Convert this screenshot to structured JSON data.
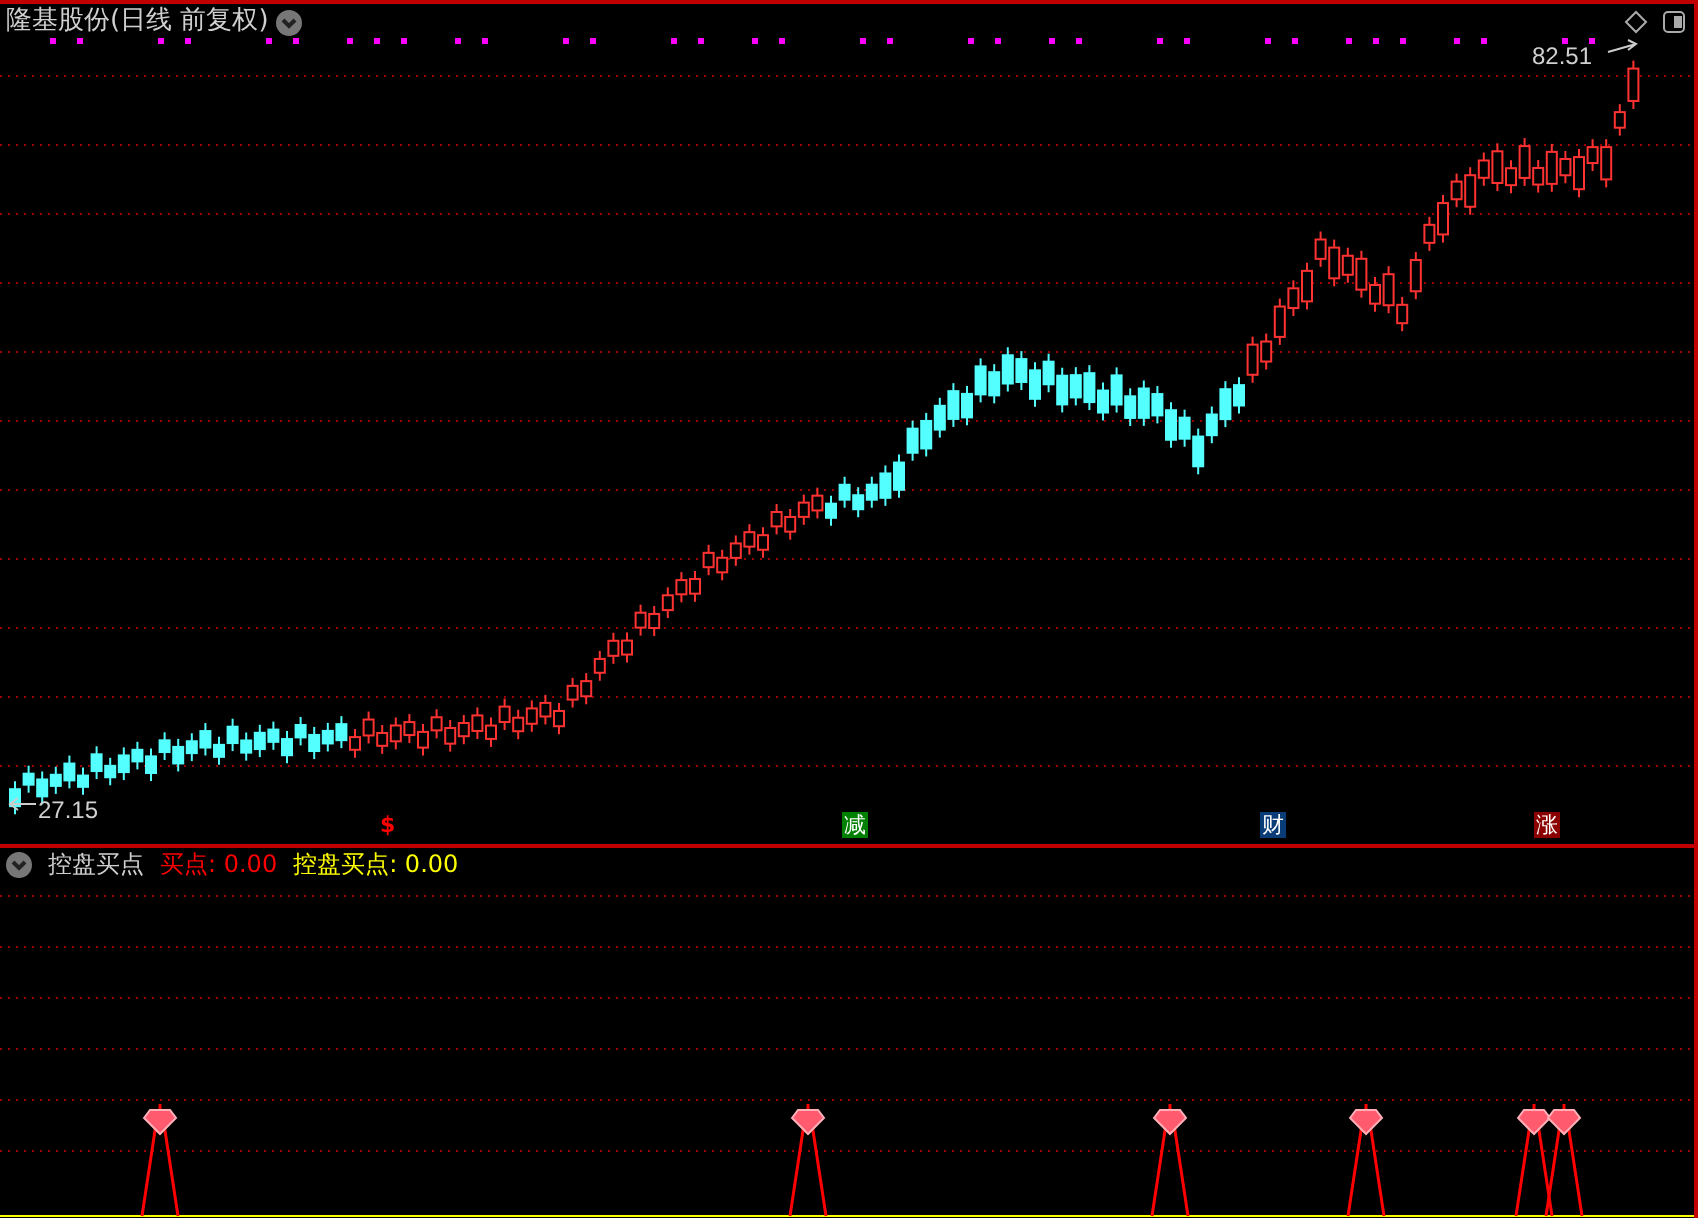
{
  "chart": {
    "title": "隆基股份(日线 前复权)",
    "high_label": "82.51",
    "low_label": "27.15",
    "markers": [
      {
        "text": "$",
        "kind": "plain",
        "color": "#ff0000"
      },
      {
        "text": "减",
        "kind": "boxed",
        "color": "#008000"
      },
      {
        "text": "财",
        "kind": "boxed",
        "color": "#0a3c78"
      },
      {
        "text": "涨",
        "kind": "boxed",
        "color": "#8b0000"
      }
    ]
  },
  "indicator": {
    "title": "控盘买点",
    "legend": [
      {
        "label": "买点:",
        "value": "0.00",
        "color": "#ff0000"
      },
      {
        "label": "控盘买点:",
        "value": "0.00",
        "color": "#ffff00"
      }
    ]
  }
}
